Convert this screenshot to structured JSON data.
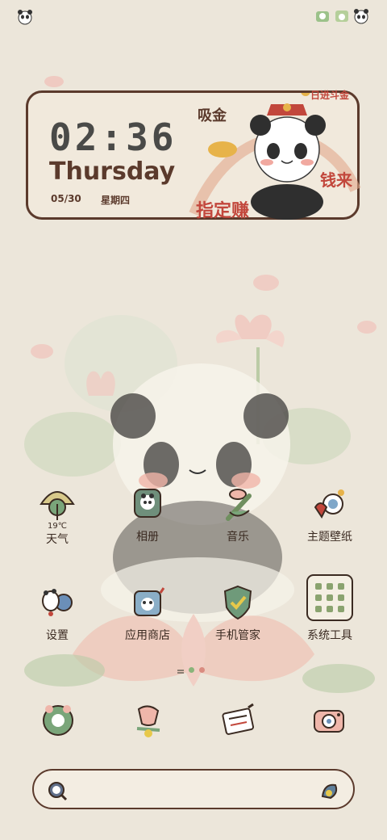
{
  "widget": {
    "time": "02:36",
    "day": "Thursday",
    "date": "05/30",
    "weekday": "星期四",
    "stamp_top": "日进斗金",
    "stamp_left": "吸金",
    "stamp_bottom": "指定赚",
    "stamp_right": "钱来"
  },
  "apps_row1": [
    {
      "label": "天气",
      "temp": "19℃",
      "icon": "weather-umbrella-icon"
    },
    {
      "label": "相册",
      "icon": "gallery-panda-icon"
    },
    {
      "label": "音乐",
      "icon": "music-flute-icon"
    },
    {
      "label": "主题壁纸",
      "icon": "theme-palette-icon"
    }
  ],
  "apps_row2": [
    {
      "label": "设置",
      "icon": "settings-panda-icon"
    },
    {
      "label": "应用商店",
      "icon": "app-store-bag-icon"
    },
    {
      "label": "手机管家",
      "icon": "phone-manager-shield-icon"
    },
    {
      "label": "系统工具",
      "icon": "system-tools-folder-icon"
    }
  ],
  "dock": [
    {
      "icon": "phone-icon"
    },
    {
      "icon": "messages-icon"
    },
    {
      "icon": "browser-icon"
    },
    {
      "icon": "camera-icon"
    }
  ],
  "colors": {
    "background": "#ece6da",
    "frame": "#5b3a2c",
    "accent_red": "#c2473c",
    "dot_active": "#8ab47a",
    "dot_inactive": "#d98c80"
  },
  "page_indicator": {
    "current": 1,
    "total": 2
  }
}
